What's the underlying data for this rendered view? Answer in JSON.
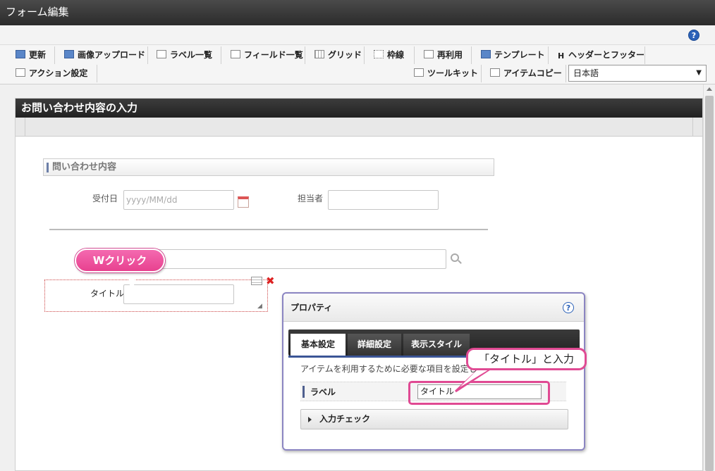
{
  "window": {
    "title": "フォーム編集",
    "help": "?"
  },
  "toolbar": {
    "row1": [
      "更新",
      "画像アップロード",
      "ラベル一覧",
      "フィールド一覧",
      "グリッド",
      "枠線",
      "再利用",
      "テンプレート",
      "ヘッダーとフッター"
    ],
    "row2": [
      "アクション設定",
      "ツールキット",
      "アイテムコピー"
    ],
    "language": "日本語"
  },
  "panel": {
    "title": "お問い合わせ内容の入力"
  },
  "form": {
    "section_title": "問い合わせ内容",
    "received_label": "受付日",
    "received_placeholder": "yyyy/MM/dd",
    "owner_label": "担当者",
    "title_label": "タイトル"
  },
  "annotations": {
    "double_click": "Wクリック",
    "enter_title": "「タイトル」と入力"
  },
  "properties": {
    "title": "プロパティ",
    "help": "?",
    "tabs": [
      "基本設定",
      "詳細設定",
      "表示スタイル"
    ],
    "description": "アイテムを利用するために必要な項目を設定し",
    "label_field": "ラベル",
    "label_value": "タイトル",
    "input_check": "入力チェック"
  }
}
